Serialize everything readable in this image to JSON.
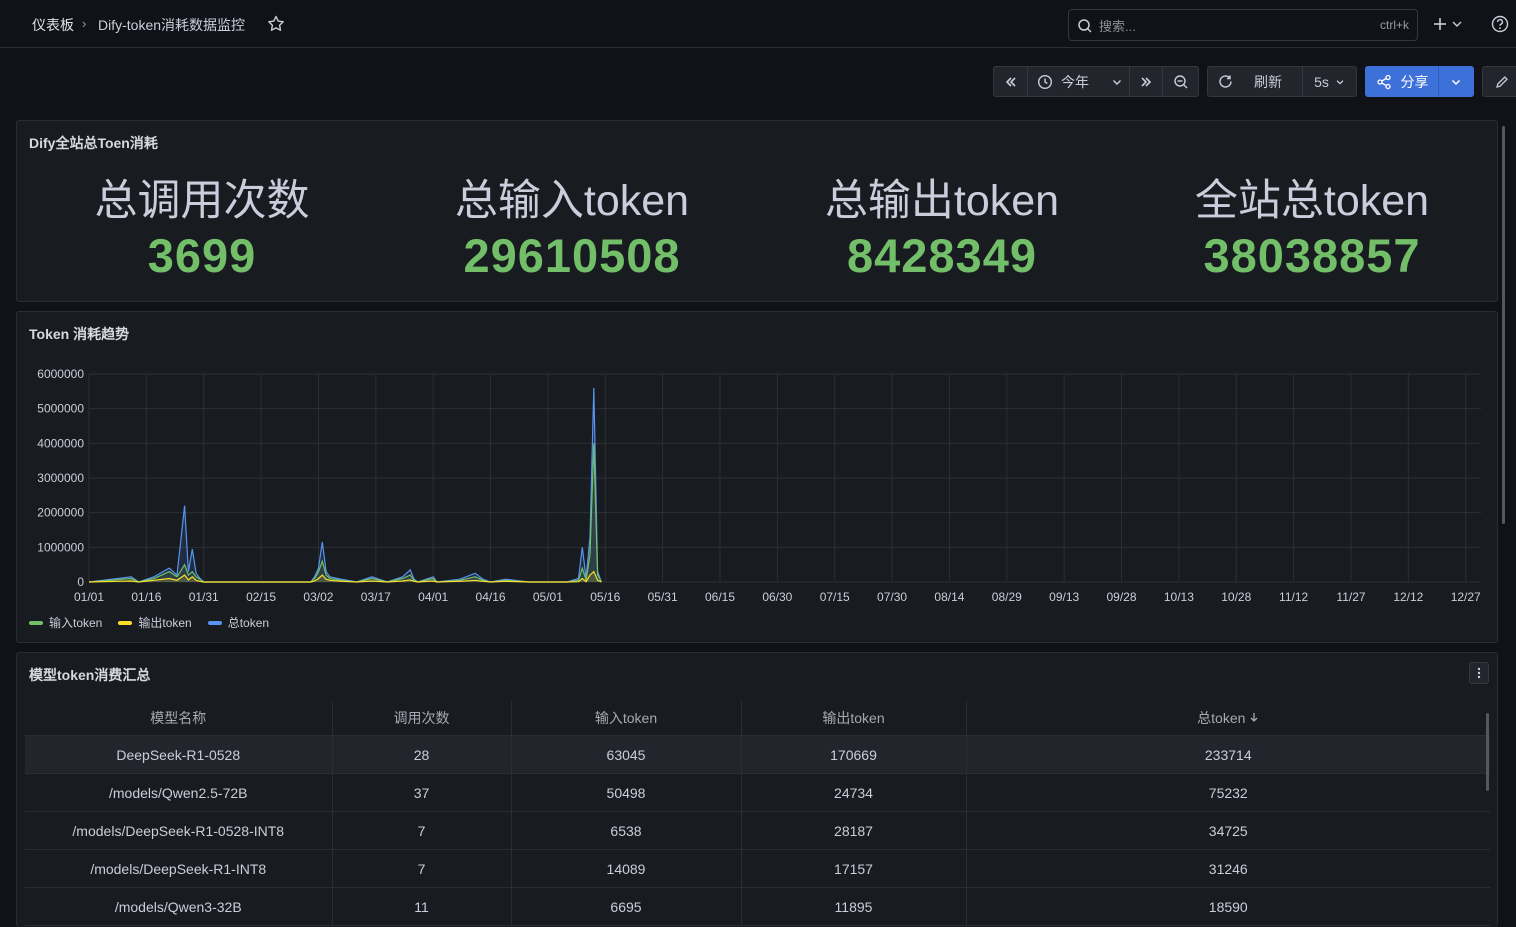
{
  "header": {
    "breadcrumb_home": "仪表板",
    "breadcrumb_sep": "›",
    "dashboard_title": "Dify-token消耗数据监控",
    "search_placeholder": "搜索...",
    "search_shortcut": "ctrl+k"
  },
  "toolbar": {
    "time_range": "今年",
    "refresh_label": "刷新",
    "refresh_interval": "5s",
    "share_label": "分享"
  },
  "summary_panel": {
    "title": "Dify全站总Toen消耗",
    "stats": [
      {
        "label": "总调用次数",
        "value": "3699"
      },
      {
        "label": "总输入token",
        "value": "29610508"
      },
      {
        "label": "总输出token",
        "value": "8428349"
      },
      {
        "label": "全站总token",
        "value": "38038857"
      }
    ]
  },
  "trend_panel": {
    "title": "Token 消耗趋势",
    "colors": {
      "input": "#73bf69",
      "output": "#fade2a",
      "total": "#5794f2"
    },
    "chart_data": {
      "type": "line",
      "title": "Token 消耗趋势",
      "ylim": [
        0,
        6000000
      ],
      "y_ticks": [
        "6000000",
        "5000000",
        "4000000",
        "3000000",
        "2000000",
        "1000000",
        "0"
      ],
      "x_ticks": [
        "01/01",
        "01/16",
        "01/31",
        "02/15",
        "03/02",
        "03/17",
        "04/01",
        "04/16",
        "05/01",
        "05/16",
        "05/31",
        "06/15",
        "06/30",
        "07/15",
        "07/30",
        "08/14",
        "08/29",
        "09/13",
        "09/28",
        "10/13",
        "10/28",
        "11/12",
        "11/27",
        "12/12",
        "12/27"
      ],
      "x_range": [
        "01/01",
        "12/31"
      ],
      "legend_position": "bottom-left",
      "x": [
        "01/01",
        "01/12",
        "01/14",
        "01/18",
        "01/22",
        "01/24",
        "01/26",
        "01/27",
        "01/28",
        "01/29",
        "01/30",
        "01/31",
        "02/02",
        "02/10",
        "02/20",
        "02/28",
        "03/01",
        "03/02",
        "03/03",
        "03/04",
        "03/05",
        "03/08",
        "03/12",
        "03/16",
        "03/20",
        "03/24",
        "03/26",
        "03/27",
        "03/28",
        "04/01",
        "04/02",
        "04/08",
        "04/12",
        "04/14",
        "04/16",
        "04/20",
        "04/26",
        "05/06",
        "05/09",
        "05/10",
        "05/11",
        "05/12",
        "05/13",
        "05/14",
        "05/15"
      ],
      "series": [
        {
          "name": "输入token",
          "values": [
            0,
            100000,
            0,
            100000,
            300000,
            150000,
            500000,
            200000,
            300000,
            150000,
            80000,
            0,
            0,
            0,
            0,
            0,
            100000,
            300000,
            600000,
            200000,
            100000,
            50000,
            0,
            100000,
            0,
            100000,
            200000,
            50000,
            0,
            100000,
            0,
            50000,
            150000,
            50000,
            0,
            50000,
            0,
            0,
            50000,
            400000,
            50000,
            800000,
            4000000,
            200000,
            0
          ]
        },
        {
          "name": "输出token",
          "values": [
            0,
            30000,
            0,
            50000,
            100000,
            50000,
            200000,
            60000,
            150000,
            50000,
            20000,
            0,
            0,
            0,
            0,
            0,
            30000,
            100000,
            200000,
            80000,
            50000,
            20000,
            0,
            30000,
            0,
            30000,
            60000,
            20000,
            0,
            30000,
            0,
            20000,
            50000,
            20000,
            0,
            20000,
            0,
            0,
            10000,
            100000,
            10000,
            200000,
            300000,
            50000,
            0
          ]
        },
        {
          "name": "总token",
          "values": [
            0,
            150000,
            0,
            150000,
            400000,
            200000,
            2200000,
            300000,
            950000,
            250000,
            100000,
            0,
            0,
            0,
            0,
            0,
            150000,
            400000,
            1150000,
            300000,
            150000,
            80000,
            0,
            150000,
            0,
            150000,
            350000,
            80000,
            0,
            150000,
            0,
            80000,
            250000,
            80000,
            0,
            80000,
            0,
            0,
            100000,
            1000000,
            100000,
            1300000,
            5600000,
            300000,
            0
          ]
        }
      ]
    }
  },
  "table_panel": {
    "title": "模型token消费汇总",
    "columns": [
      "模型名称",
      "调用次数",
      "输入token",
      "输出token",
      "总token"
    ],
    "rows": [
      [
        "DeepSeek-R1-0528",
        "28",
        "63045",
        "170669",
        "233714"
      ],
      [
        "/models/Qwen2.5-72B",
        "37",
        "50498",
        "24734",
        "75232"
      ],
      [
        "/models/DeepSeek-R1-0528-INT8",
        "7",
        "6538",
        "28187",
        "34725"
      ],
      [
        "/models/DeepSeek-R1-INT8",
        "7",
        "14089",
        "17157",
        "31246"
      ],
      [
        "/models/Qwen3-32B",
        "11",
        "6695",
        "11895",
        "18590"
      ]
    ]
  }
}
